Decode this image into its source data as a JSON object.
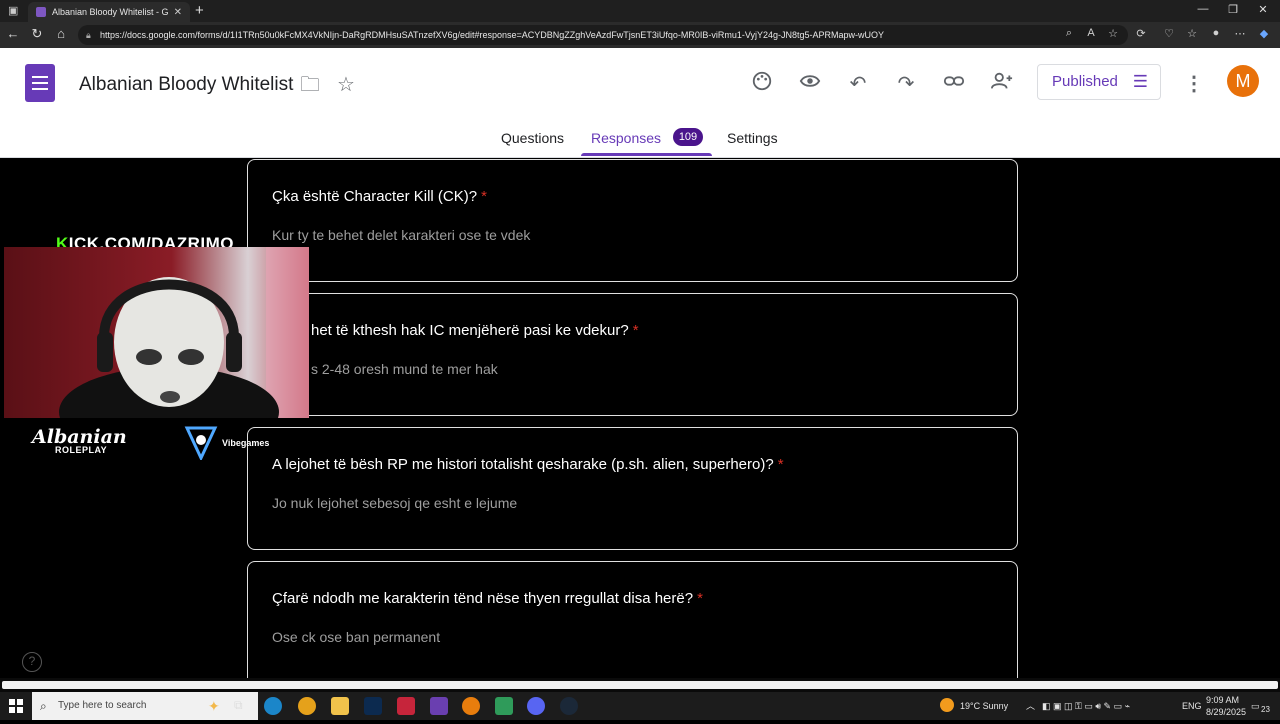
{
  "browser": {
    "tab_title": "Albanian Bloody Whitelist - Goog",
    "tab_close": "✕",
    "new_tab": "+",
    "url": "https://docs.google.com/forms/d/1I1TRn50u0kFcMX4VkNIjn-DaRgRDMHsuSATnzefXV6g/edit#response=ACYDBNgZZghVeAzdFwTjsnET3iUfqo-MR0IB-viRmu1-VyjY24g-JN8tg5-APRMapw-wUOY"
  },
  "form": {
    "title": "Albanian Bloody Whitelist",
    "publish_label": "Published",
    "avatar_letter": "M",
    "tabs": {
      "questions": "Questions",
      "responses": "Responses",
      "responses_count": "109",
      "settings": "Settings"
    }
  },
  "responses": [
    {
      "question": "Çka është Character Kill (CK)?",
      "required": "*",
      "answer": "Kur ty te behet delet karakteri ose te vdek"
    },
    {
      "question": "het të kthesh hak IC menjëherë pasi ke vdekur?",
      "required": "*",
      "answer": "s 2-48 oresh mund te mer hak"
    },
    {
      "question": "A lejohet të bësh RP me histori totalisht qesharake (p.sh. alien, superhero)?",
      "required": "*",
      "answer": "Jo nuk lejohet sebesoj qe esht e lejume"
    },
    {
      "question": "Çfarë ndodh me karakterin tënd nëse thyen rregullat disa herë?",
      "required": "*",
      "answer": "Ose ck ose ban permanent"
    }
  ],
  "overlay": {
    "kick_k": "K",
    "kick_rest": "ICK.COM/DAZRIMO",
    "logo_name": "Albanian",
    "logo_sub": "ROLEPLAY",
    "vibe": "Vibegames"
  },
  "taskbar": {
    "search_placeholder": "Type here to search",
    "weather": "19°C  Sunny",
    "language": "ENG",
    "time": "9:09 AM",
    "date": "8/29/2025",
    "notifications": "23"
  },
  "colors": {
    "accent": "#673ab7",
    "badge": "#4a148c",
    "required": "#d93025",
    "kick_green": "#53fc18"
  }
}
